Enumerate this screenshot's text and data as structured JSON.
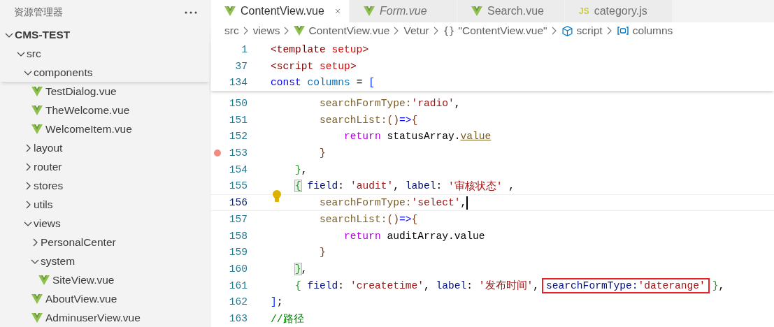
{
  "sidebar": {
    "title": "资源管理器",
    "tree": [
      {
        "label": "CMS-TEST",
        "kind": "root",
        "expanded": true,
        "children": [
          {
            "label": "src",
            "kind": "folder",
            "expanded": true,
            "children": [
              {
                "label": "components",
                "kind": "folder",
                "expanded": true,
                "children": [
                  {
                    "label": "TestDialog.vue",
                    "kind": "file"
                  },
                  {
                    "label": "TheWelcome.vue",
                    "kind": "file"
                  },
                  {
                    "label": "WelcomeItem.vue",
                    "kind": "file"
                  }
                ]
              },
              {
                "label": "layout",
                "kind": "folder",
                "expanded": false
              },
              {
                "label": "router",
                "kind": "folder",
                "expanded": false
              },
              {
                "label": "stores",
                "kind": "folder",
                "expanded": false
              },
              {
                "label": "utils",
                "kind": "folder",
                "expanded": false
              },
              {
                "label": "views",
                "kind": "folder",
                "expanded": true,
                "children": [
                  {
                    "label": "PersonalCenter",
                    "kind": "folder",
                    "expanded": false
                  },
                  {
                    "label": "system",
                    "kind": "folder",
                    "expanded": true,
                    "children": [
                      {
                        "label": "SiteView.vue",
                        "kind": "file"
                      }
                    ]
                  },
                  {
                    "label": "AboutView.vue",
                    "kind": "file"
                  },
                  {
                    "label": "AdminuserView.vue",
                    "kind": "file"
                  }
                ]
              }
            ]
          }
        ]
      }
    ]
  },
  "tabs": [
    {
      "label": "ContentView.vue",
      "kind": "vue",
      "selected": true,
      "preview": false
    },
    {
      "label": "Form.vue",
      "kind": "vue",
      "selected": false,
      "preview": true
    },
    {
      "label": "Search.vue",
      "kind": "vue",
      "selected": false,
      "preview": false
    },
    {
      "label": "category.js",
      "kind": "js",
      "glyph": "JS",
      "selected": false,
      "preview": false
    }
  ],
  "breadcrumbs": [
    {
      "label": "src",
      "kind": "text"
    },
    {
      "label": "views",
      "kind": "text"
    },
    {
      "label": "ContentView.vue",
      "kind": "vue"
    },
    {
      "label": "Vetur",
      "kind": "text"
    },
    {
      "label": "\"ContentView.vue\"",
      "kind": "object",
      "glyph": "{}"
    },
    {
      "label": "script",
      "kind": "module"
    },
    {
      "label": "columns",
      "kind": "variable"
    }
  ],
  "sticky_lines": [
    {
      "number": "1",
      "tokens": [
        {
          "text": "<template",
          "kind": "tag"
        },
        {
          "text": " setup",
          "kind": "attr"
        },
        {
          "text": ">",
          "kind": "tag"
        }
      ]
    },
    {
      "number": "37",
      "tokens": [
        {
          "text": "<script",
          "kind": "tag"
        },
        {
          "text": " setup",
          "kind": "attr"
        },
        {
          "text": ">",
          "kind": "tag"
        }
      ]
    },
    {
      "number": "134",
      "tokens": [
        {
          "text": "const",
          "kind": "keyword"
        },
        {
          "text": " columns",
          "kind": "variable"
        },
        {
          "text": " = ",
          "kind": "plain"
        },
        {
          "text": "[",
          "kind": "bracket1"
        }
      ]
    }
  ],
  "lines": [
    {
      "number": "150",
      "tokens": [
        {
          "text": "        searchFormType:",
          "kind": "method"
        },
        {
          "text": "'radio'",
          "kind": "string"
        },
        {
          "text": ",",
          "kind": "plain"
        }
      ]
    },
    {
      "number": "151",
      "tokens": [
        {
          "text": "        searchList:",
          "kind": "method"
        },
        {
          "text": "()",
          "kind": "bracket3"
        },
        {
          "text": "=>",
          "kind": "keyword"
        },
        {
          "text": "{",
          "kind": "bracket3"
        }
      ]
    },
    {
      "number": "152",
      "tokens": [
        {
          "text": "            return",
          "kind": "control"
        },
        {
          "text": " statusArray.",
          "kind": "plain"
        },
        {
          "text": "value",
          "kind": "underlined"
        }
      ]
    },
    {
      "number": "153",
      "breakpoint": true,
      "tokens": [
        {
          "text": "        }",
          "kind": "bracket3"
        }
      ]
    },
    {
      "number": "154",
      "tokens": [
        {
          "text": "    }",
          "kind": "bracket2"
        },
        {
          "text": ",",
          "kind": "plain"
        }
      ]
    },
    {
      "number": "155",
      "tokens": [
        {
          "text": "    {",
          "kind": "match"
        },
        {
          "text": " field",
          "kind": "property"
        },
        {
          "text": ": ",
          "kind": "plain"
        },
        {
          "text": "'audit'",
          "kind": "string"
        },
        {
          "text": ", ",
          "kind": "plain"
        },
        {
          "text": "label",
          "kind": "property"
        },
        {
          "text": ": ",
          "kind": "plain"
        },
        {
          "text": "'审核状态'",
          "kind": "string"
        },
        {
          "text": " ,",
          "kind": "plain"
        }
      ]
    },
    {
      "number": "156",
      "current": true,
      "lightbulb": true,
      "tokens": [
        {
          "text": "        searchFormType:",
          "kind": "method"
        },
        {
          "text": "'select'",
          "kind": "string"
        },
        {
          "text": ",",
          "kind": "plain"
        },
        {
          "kind": "cursor"
        }
      ]
    },
    {
      "number": "157",
      "tokens": [
        {
          "text": "        searchList:",
          "kind": "method"
        },
        {
          "text": "()",
          "kind": "bracket3"
        },
        {
          "text": "=>",
          "kind": "keyword"
        },
        {
          "text": "{",
          "kind": "bracket3"
        }
      ]
    },
    {
      "number": "158",
      "tokens": [
        {
          "text": "            return",
          "kind": "control"
        },
        {
          "text": " auditArray.value",
          "kind": "plain"
        }
      ]
    },
    {
      "number": "159",
      "tokens": [
        {
          "text": "        }",
          "kind": "bracket3"
        }
      ]
    },
    {
      "number": "160",
      "tokens": [
        {
          "text": "    }",
          "kind": "match"
        },
        {
          "text": ",",
          "kind": "plain"
        }
      ]
    },
    {
      "number": "161",
      "tokens": [
        {
          "text": "    {",
          "kind": "bracket2"
        },
        {
          "text": " field",
          "kind": "property"
        },
        {
          "text": ": ",
          "kind": "plain"
        },
        {
          "text": "'createtime'",
          "kind": "string"
        },
        {
          "text": ", ",
          "kind": "plain"
        },
        {
          "text": "label",
          "kind": "property"
        },
        {
          "text": ": ",
          "kind": "plain"
        },
        {
          "text": "'发布时间'",
          "kind": "string"
        },
        {
          "text": ",",
          "kind": "plain"
        },
        {
          "kind": "box",
          "children": [
            {
              "text": "searchFormType:",
              "kind": "property"
            },
            {
              "text": "'daterange'",
              "kind": "string"
            }
          ]
        },
        {
          "text": "}",
          "kind": "bracket2"
        },
        {
          "text": ",",
          "kind": "plain"
        }
      ]
    },
    {
      "number": "162",
      "tokens": [
        {
          "text": "]",
          "kind": "bracket1"
        },
        {
          "text": ";",
          "kind": "plain"
        }
      ]
    },
    {
      "number": "163",
      "tokens": [
        {
          "text": "//路径",
          "kind": "comment"
        }
      ]
    }
  ]
}
